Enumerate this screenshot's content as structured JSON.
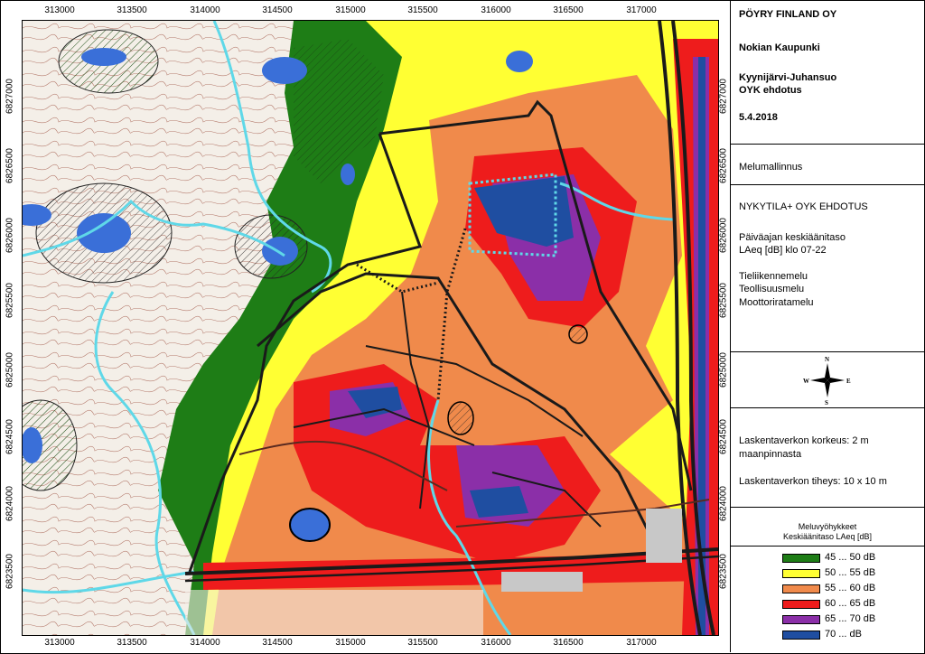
{
  "map": {
    "x_ticks": [
      "313000",
      "313500",
      "314000",
      "314500",
      "315000",
      "315500",
      "316000",
      "316500",
      "317000"
    ],
    "y_ticks": [
      "6827000",
      "6826500",
      "6826000",
      "6825500",
      "6825000",
      "6824500",
      "6824000",
      "6823500"
    ]
  },
  "panel": {
    "company": "PÖYRY FINLAND OY",
    "client": "Nokian Kaupunki",
    "project_line1": "Kyynijärvi-Juhansuo",
    "project_line2": "OYK ehdotus",
    "date": "5.4.2018",
    "model": "Melumallinnus",
    "scenario": "NYKYTILA+ OYK EHDOTUS",
    "level_line1": "Päiväajan keskiäänitaso",
    "level_line2": "LAeq [dB] klo 07-22",
    "source1": "Tieliikennemelu",
    "source2": "Teollisuusmelu",
    "source3": "Moottoriratamelu",
    "compass": {
      "n": "N",
      "e": "E",
      "s": "S",
      "w": "W"
    },
    "grid_height_line1": "Laskentaverkon korkeus: 2 m",
    "grid_height_line2": "maanpinnasta",
    "grid_density": "Laskentaverkon tiheys:  10 x 10 m"
  },
  "legend": {
    "title1": "Meluvyöhykkeet",
    "title2": "Keskiäänitaso LAeq [dB]",
    "items": [
      {
        "label": "45 ... 50 dB",
        "color": "#1e7d16"
      },
      {
        "label": "50 ... 55 dB",
        "color": "#ffff33"
      },
      {
        "label": "55 ... 60 dB",
        "color": "#f08a4b"
      },
      {
        "label": "60 ... 65 dB",
        "color": "#ee1c1c"
      },
      {
        "label": "65 ... 70 dB",
        "color": "#8b2fa8"
      },
      {
        "label": "70 ...    dB",
        "color": "#1f4ea1"
      }
    ]
  },
  "colors": {
    "water": "#3a6fd8",
    "river": "#5fd8e8",
    "contour": "#9a4a3a",
    "road": "#1a1a1a"
  }
}
